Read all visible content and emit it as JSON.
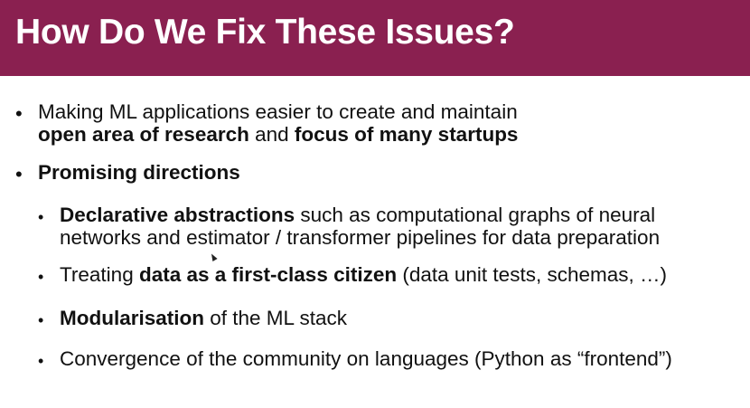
{
  "slide": {
    "title": "How Do We Fix These Issues?",
    "bullet_char": "•",
    "point1": {
      "line1": "Making ML applications easier to create and maintain",
      "bold1": "open area of research",
      "conj": " and ",
      "bold2": "focus of many startups"
    },
    "point2": {
      "label": "Promising directions"
    },
    "sub1": {
      "bold": "Declarative abstractions",
      "rest": " such as computational graphs of neural",
      "line2": "networks and estimator / transformer pipelines for data preparation"
    },
    "sub2": {
      "pre": "Treating ",
      "bold": "data as a first-class citizen",
      "rest": " (data unit tests, schemas, …)"
    },
    "sub3": {
      "bold": "Modularisation",
      "rest": " of the ML stack"
    },
    "sub4": {
      "text": "Convergence of the community on languages (Python as “frontend”)"
    }
  }
}
